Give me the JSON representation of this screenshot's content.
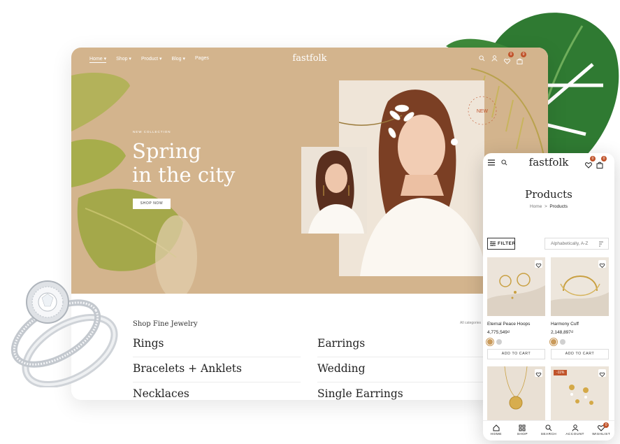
{
  "desktop": {
    "nav": [
      {
        "label": "Home ▾"
      },
      {
        "label": "Shop ▾"
      },
      {
        "label": "Product ▾"
      },
      {
        "label": "Blog ▾"
      },
      {
        "label": "Pages"
      }
    ],
    "logo": "fastfolk",
    "wishlist_count": "0",
    "cart_count": "0",
    "hero": {
      "eyebrow": "NEW COLLECTION",
      "headline_line1": "Spring",
      "headline_line2": "in the city",
      "cta": "SHOP NOW",
      "badge_text": "NEW"
    },
    "categories_title": "Shop Fine Jewelry",
    "all_categories": "All categories",
    "categories": [
      "Rings",
      "Earrings",
      "Bracelets + Anklets",
      "Wedding",
      "Necklaces",
      "Single Earrings"
    ]
  },
  "mobile": {
    "logo": "fastfolk",
    "wishlist_count": "0",
    "cart_count": "0",
    "page_title": "Products",
    "breadcrumb_home": "Home",
    "breadcrumb_sep": ">",
    "breadcrumb_current": "Products",
    "filter_label": "FILTER",
    "sort_label": "Alphabetically, A-Z",
    "products": [
      {
        "name": "Eternal Peace Hoops",
        "price": "4,775,549₫",
        "cta": "ADD TO CART",
        "swatches": [
          "#c99a5b",
          "#d0d0d0"
        ]
      },
      {
        "name": "Harmony Cuff",
        "price": "2,148,897₫",
        "cta": "ADD TO CART",
        "swatches": [
          "#c99a5b",
          "#d0d0d0"
        ]
      },
      {
        "sale_badge": ""
      },
      {
        "sale_badge": "-11%"
      }
    ],
    "tabs": [
      {
        "label": "HOME"
      },
      {
        "label": "SHOP"
      },
      {
        "label": "SEARCH"
      },
      {
        "label": "ACCOUNT"
      },
      {
        "label": "WISHLIST",
        "badge": "0"
      }
    ]
  },
  "colors": {
    "hero_bg": "#d3b48d",
    "accent": "#c0532a",
    "leaf_green": "#2f7a32",
    "olive_leaf": "#a7ad4b"
  }
}
